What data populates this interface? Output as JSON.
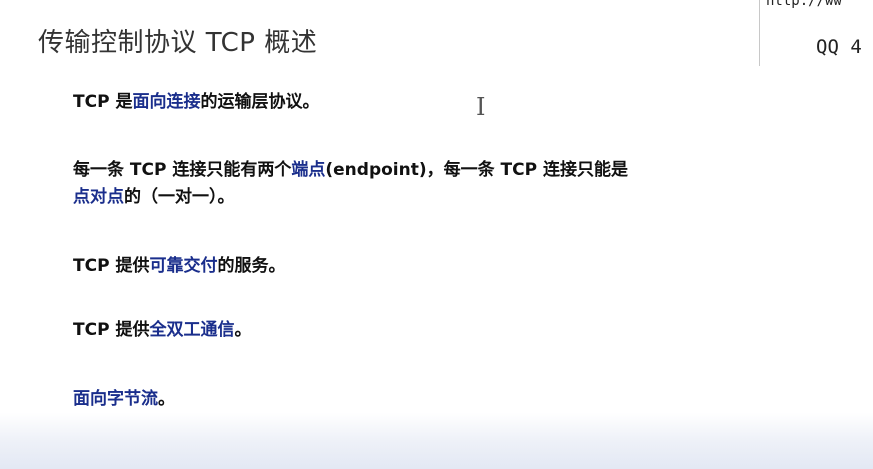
{
  "slide": {
    "title": "传输控制协议 TCP 概述",
    "points": [
      {
        "lines": [
          [
            {
              "t": "TCP 是"
            },
            {
              "t": "面向连接",
              "hl": true
            },
            {
              "t": "的运输层协议。"
            }
          ]
        ]
      },
      {
        "lines": [
          [
            {
              "t": "每一条 TCP 连接只能有两个"
            },
            {
              "t": "端点",
              "hl": true
            },
            {
              "t": "(endpoint)，每一条 TCP 连接只能是"
            }
          ],
          [
            {
              "t": "点对点",
              "hl": true
            },
            {
              "t": "的（一对一）。"
            }
          ]
        ]
      },
      {
        "lines": [
          [
            {
              "t": "TCP 提供"
            },
            {
              "t": "可靠交付",
              "hl": true
            },
            {
              "t": "的服务。"
            }
          ]
        ]
      },
      {
        "lines": [
          [
            {
              "t": "TCP 提供"
            },
            {
              "t": "全双工通信",
              "hl": true
            },
            {
              "t": "。"
            }
          ]
        ]
      },
      {
        "lines": [
          [
            {
              "t": "面向字节流",
              "hl": true
            },
            {
              "t": "。"
            }
          ]
        ]
      }
    ]
  },
  "side_panel": {
    "url_fragment": "http://ww",
    "qq_fragment": "QQ 4"
  },
  "colors": {
    "highlight": "#1a2e8c",
    "text": "#111111",
    "title": "#333333"
  }
}
